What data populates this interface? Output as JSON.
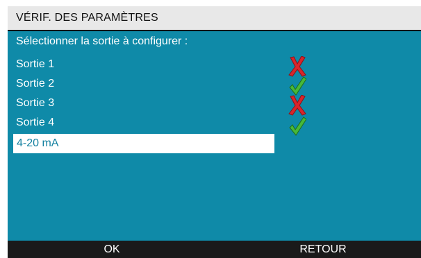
{
  "header": {
    "title": "VÉRIF. DES PARAMÈTRES"
  },
  "main": {
    "prompt": "Sélectionner la sortie à configurer :",
    "outputs": [
      {
        "label": "Sortie 1",
        "status": "fail",
        "status_icon": "red-x-icon"
      },
      {
        "label": "Sortie 2",
        "status": "pass",
        "status_icon": "green-check-icon"
      },
      {
        "label": "Sortie 3",
        "status": "fail",
        "status_icon": "red-x-icon"
      },
      {
        "label": "Sortie 4",
        "status": "pass",
        "status_icon": "green-check-icon"
      }
    ],
    "selected_value": "4-20 mA"
  },
  "softkeys": {
    "ok_label": "OK",
    "back_label": "RETOUR"
  },
  "colors": {
    "panel_bg": "#0f8aa8",
    "title_bg": "#e8e8e8",
    "softkey_bg": "#1a1a1a",
    "fail": "#d8262c",
    "pass": "#46b83a"
  }
}
